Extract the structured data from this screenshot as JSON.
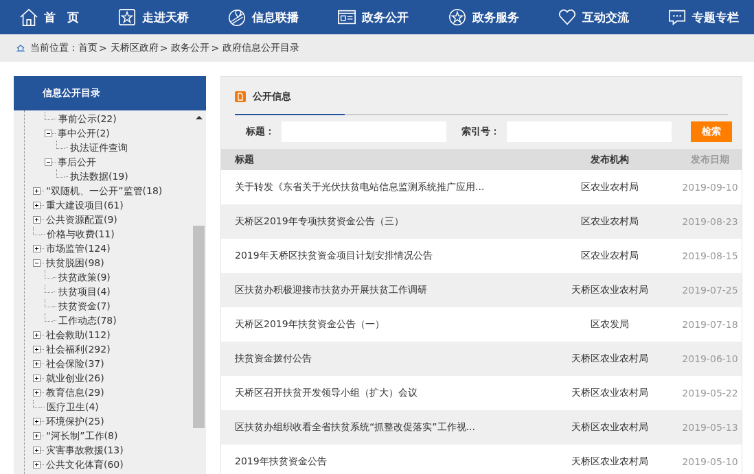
{
  "nav": [
    {
      "label": "首　页"
    },
    {
      "label": "走进天桥"
    },
    {
      "label": "信息联播"
    },
    {
      "label": "政务公开"
    },
    {
      "label": "政务服务"
    },
    {
      "label": "互动交流"
    },
    {
      "label": "专题专栏"
    }
  ],
  "breadcrumb": {
    "prefix": "当前位置：",
    "items": [
      {
        "label": "首页",
        "separator": ">"
      },
      {
        "label": "天桥区政府",
        "separator": ">"
      },
      {
        "label": "政务公开",
        "separator": ">"
      },
      {
        "label": "政府信息公开目录"
      }
    ]
  },
  "sidebar": {
    "title": "信息公开目录",
    "tree": [
      {
        "kind": "hidden",
        "children": [
          {
            "kind": "leaf",
            "label": "事前公示(22)"
          },
          {
            "kind": "folder",
            "label": "事中公开(2)",
            "expanded": true,
            "children": [
              {
                "kind": "leaf",
                "label": "执法证件查询"
              }
            ]
          },
          {
            "kind": "folder",
            "label": "事后公开",
            "expanded": true,
            "children": [
              {
                "kind": "leaf",
                "label": "执法数据(19)"
              }
            ]
          }
        ]
      },
      {
        "kind": "folder",
        "label": "“双随机、一公开”监管(18)",
        "expanded": false
      },
      {
        "kind": "folder",
        "label": "重大建设项目(61)",
        "expanded": false
      },
      {
        "kind": "folder",
        "label": "公共资源配置(9)",
        "expanded": false
      },
      {
        "kind": "leaf",
        "label": "价格与收费(11)"
      },
      {
        "kind": "folder",
        "label": "市场监管(124)",
        "expanded": false
      },
      {
        "kind": "folder",
        "label": "扶贫脱困(98)",
        "expanded": true,
        "children": [
          {
            "kind": "leaf",
            "label": "扶贫政策(9)"
          },
          {
            "kind": "leaf",
            "label": "扶贫项目(4)"
          },
          {
            "kind": "leaf",
            "label": "扶贫资金(7)"
          },
          {
            "kind": "leaf",
            "label": "工作动态(78)"
          }
        ]
      },
      {
        "kind": "folder",
        "label": "社会救助(112)",
        "expanded": false
      },
      {
        "kind": "folder",
        "label": "社会福利(292)",
        "expanded": false
      },
      {
        "kind": "folder",
        "label": "社会保险(37)",
        "expanded": false
      },
      {
        "kind": "folder",
        "label": "就业创业(26)",
        "expanded": false
      },
      {
        "kind": "folder",
        "label": "教育信息(29)",
        "expanded": false
      },
      {
        "kind": "leaf",
        "label": "医疗卫生(4)"
      },
      {
        "kind": "folder",
        "label": "环境保护(25)",
        "expanded": false
      },
      {
        "kind": "folder",
        "label": "“河长制”工作(8)",
        "expanded": false
      },
      {
        "kind": "folder",
        "label": "灾害事故救援(13)",
        "expanded": false
      },
      {
        "kind": "folder",
        "label": "公共文化体育(60)",
        "expanded": false
      }
    ]
  },
  "panel": {
    "tab": "公开信息",
    "search": {
      "title_label": "标题：",
      "index_label": "索引号：",
      "button": "检索"
    },
    "table": {
      "columns": [
        "标题",
        "发布机构",
        "发布日期"
      ],
      "rows": [
        [
          "关于转发《东省关于光伏扶贫电站信息监测系统推广应用...",
          "区农业农村局",
          "2019-09-10"
        ],
        [
          "天桥区2019年专项扶贫资金公告（三）",
          "区农业农村局",
          "2019-08-23"
        ],
        [
          "2019年天桥区扶贫资金项目计划安排情况公告",
          "区农业农村局",
          "2019-08-15"
        ],
        [
          "区扶贫办积极迎接市扶贫办开展扶贫工作调研",
          "天桥区农业农村局",
          "2019-07-25"
        ],
        [
          "天桥区2019年扶贫资金公告（一）",
          "区农发局",
          "2019-07-18"
        ],
        [
          "扶贫资金拨付公告",
          "天桥区农业农村局",
          "2019-06-10"
        ],
        [
          "天桥区召开扶贫开发领导小组（扩大）会议",
          "天桥区农业农村局",
          "2019-05-22"
        ],
        [
          "区扶贫办组织收看全省扶贫系统“抓整改促落实”工作视...",
          "天桥区农业农村局",
          "2019-05-13"
        ],
        [
          "2019年扶贫资金公告",
          "天桥区农业农村局",
          "2019-05-10"
        ]
      ]
    }
  }
}
